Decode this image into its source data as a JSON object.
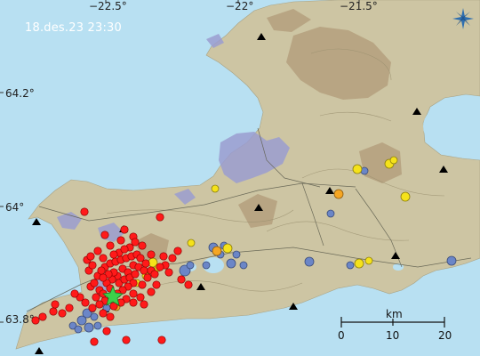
{
  "timestamp": "18.des.23  23:30",
  "lon_labels": [
    "−22.5°",
    "−22°",
    "−21.5°"
  ],
  "lat_labels": [
    "64.2°",
    "64°",
    "63.8°"
  ],
  "scale": {
    "unit": "km",
    "ticks": [
      "0",
      "10",
      "20"
    ]
  },
  "icons": {
    "compass": "compass-star-icon",
    "station": "station-triangle-icon",
    "main_event": "green-star-icon"
  },
  "colors": {
    "sea": "#b8e0f2",
    "land": "#cdc5a3",
    "lava": "#9a9cd0",
    "recent": "#ff1a1a",
    "hours": "#f5e21a",
    "day": "#f5a623",
    "older": "#6b86c7"
  }
}
